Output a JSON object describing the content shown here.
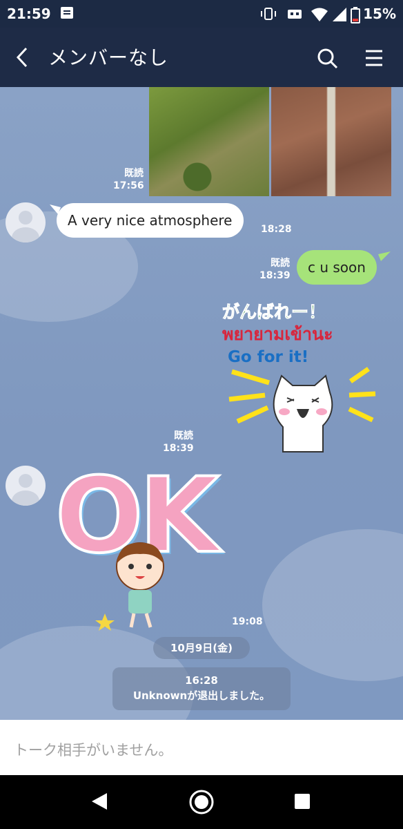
{
  "status_bar": {
    "time": "21:59",
    "battery": "15%"
  },
  "header": {
    "title": "メンバーなし"
  },
  "messages": {
    "photo_read": "既読",
    "photo_time": "17:56",
    "msg1_text": "A very nice atmosphere",
    "msg1_time": "18:28",
    "msg2_read": "既読",
    "msg2_time": "18:39",
    "msg2_text": "c u soon",
    "sticker1_line1": "がんばれー！",
    "sticker1_line2": "พยายามเข้านะ",
    "sticker1_line3": "Go for it!",
    "sticker1_read": "既読",
    "sticker1_time": "18:39",
    "sticker2_text": "OK",
    "sticker2_time": "19:08"
  },
  "date_separator": "10月9日(金)",
  "system_notice": {
    "time": "16:28",
    "text": "Unknownが退出しました。"
  },
  "input": {
    "placeholder": "トーク相手がいません。"
  },
  "colors": {
    "header_bg": "#1e2b46",
    "chat_bg": "#8aa2c6",
    "outgoing_bubble": "#a6e37a"
  }
}
